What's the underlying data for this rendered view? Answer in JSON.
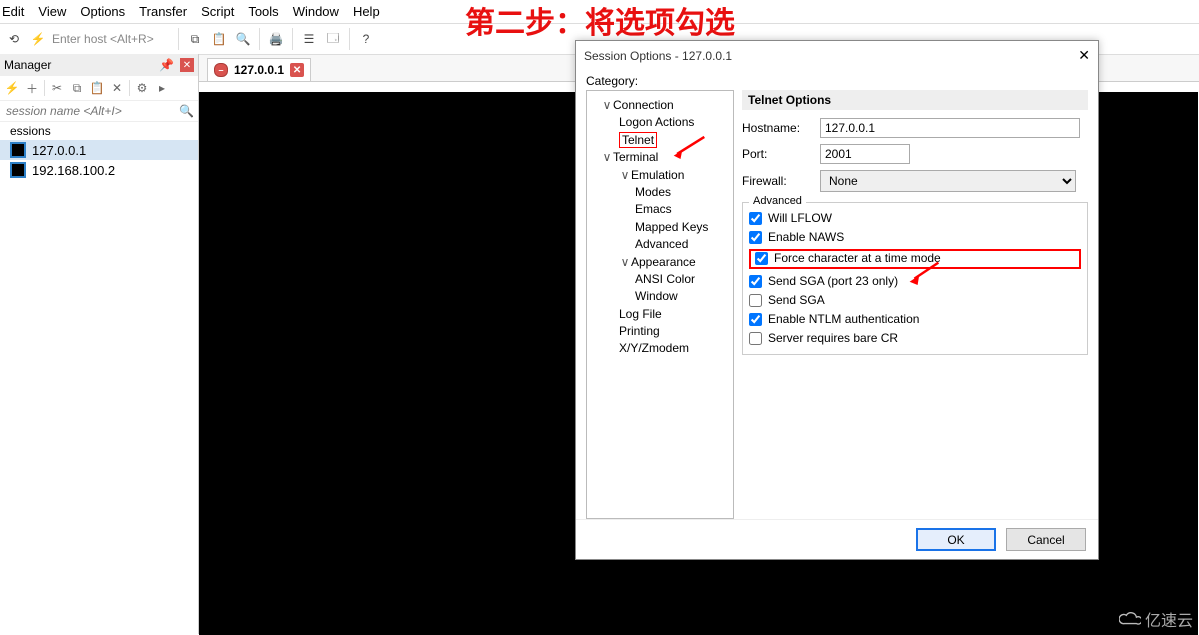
{
  "annotation": "第二步：将选项勾选",
  "menu": [
    "Edit",
    "View",
    "Options",
    "Transfer",
    "Script",
    "Tools",
    "Window",
    "Help"
  ],
  "toolbar": {
    "enter_host_placeholder": "Enter host <Alt+R>"
  },
  "tab": {
    "label": "127.0.0.1"
  },
  "session_manager": {
    "title": "Manager",
    "filter_placeholder": "session name <Alt+I>",
    "root": "essions",
    "items": [
      "127.0.0.1",
      "192.168.100.2"
    ]
  },
  "dialog": {
    "title": "Session Options - 127.0.0.1",
    "category_label": "Category:",
    "tree": {
      "connection": "Connection",
      "logon": "Logon Actions",
      "telnet": "Telnet",
      "terminal": "Terminal",
      "emulation": "Emulation",
      "modes": "Modes",
      "emacs": "Emacs",
      "mapped": "Mapped Keys",
      "advanced": "Advanced",
      "appearance": "Appearance",
      "ansi": "ANSI Color",
      "window": "Window",
      "logfile": "Log File",
      "printing": "Printing",
      "xyz": "X/Y/Zmodem"
    },
    "pane_title": "Telnet Options",
    "hostname_label": "Hostname:",
    "hostname_value": "127.0.0.1",
    "port_label": "Port:",
    "port_value": "2001",
    "firewall_label": "Firewall:",
    "firewall_value": "None",
    "advanced_legend": "Advanced",
    "checks": {
      "lflow": "Will LFLOW",
      "naws": "Enable NAWS",
      "force": "Force character at a time mode",
      "sga23": "Send SGA (port 23 only)",
      "sga": "Send SGA",
      "ntlm": "Enable NTLM authentication",
      "barecr": "Server requires bare CR"
    },
    "ok": "OK",
    "cancel": "Cancel"
  },
  "watermark": "亿速云"
}
